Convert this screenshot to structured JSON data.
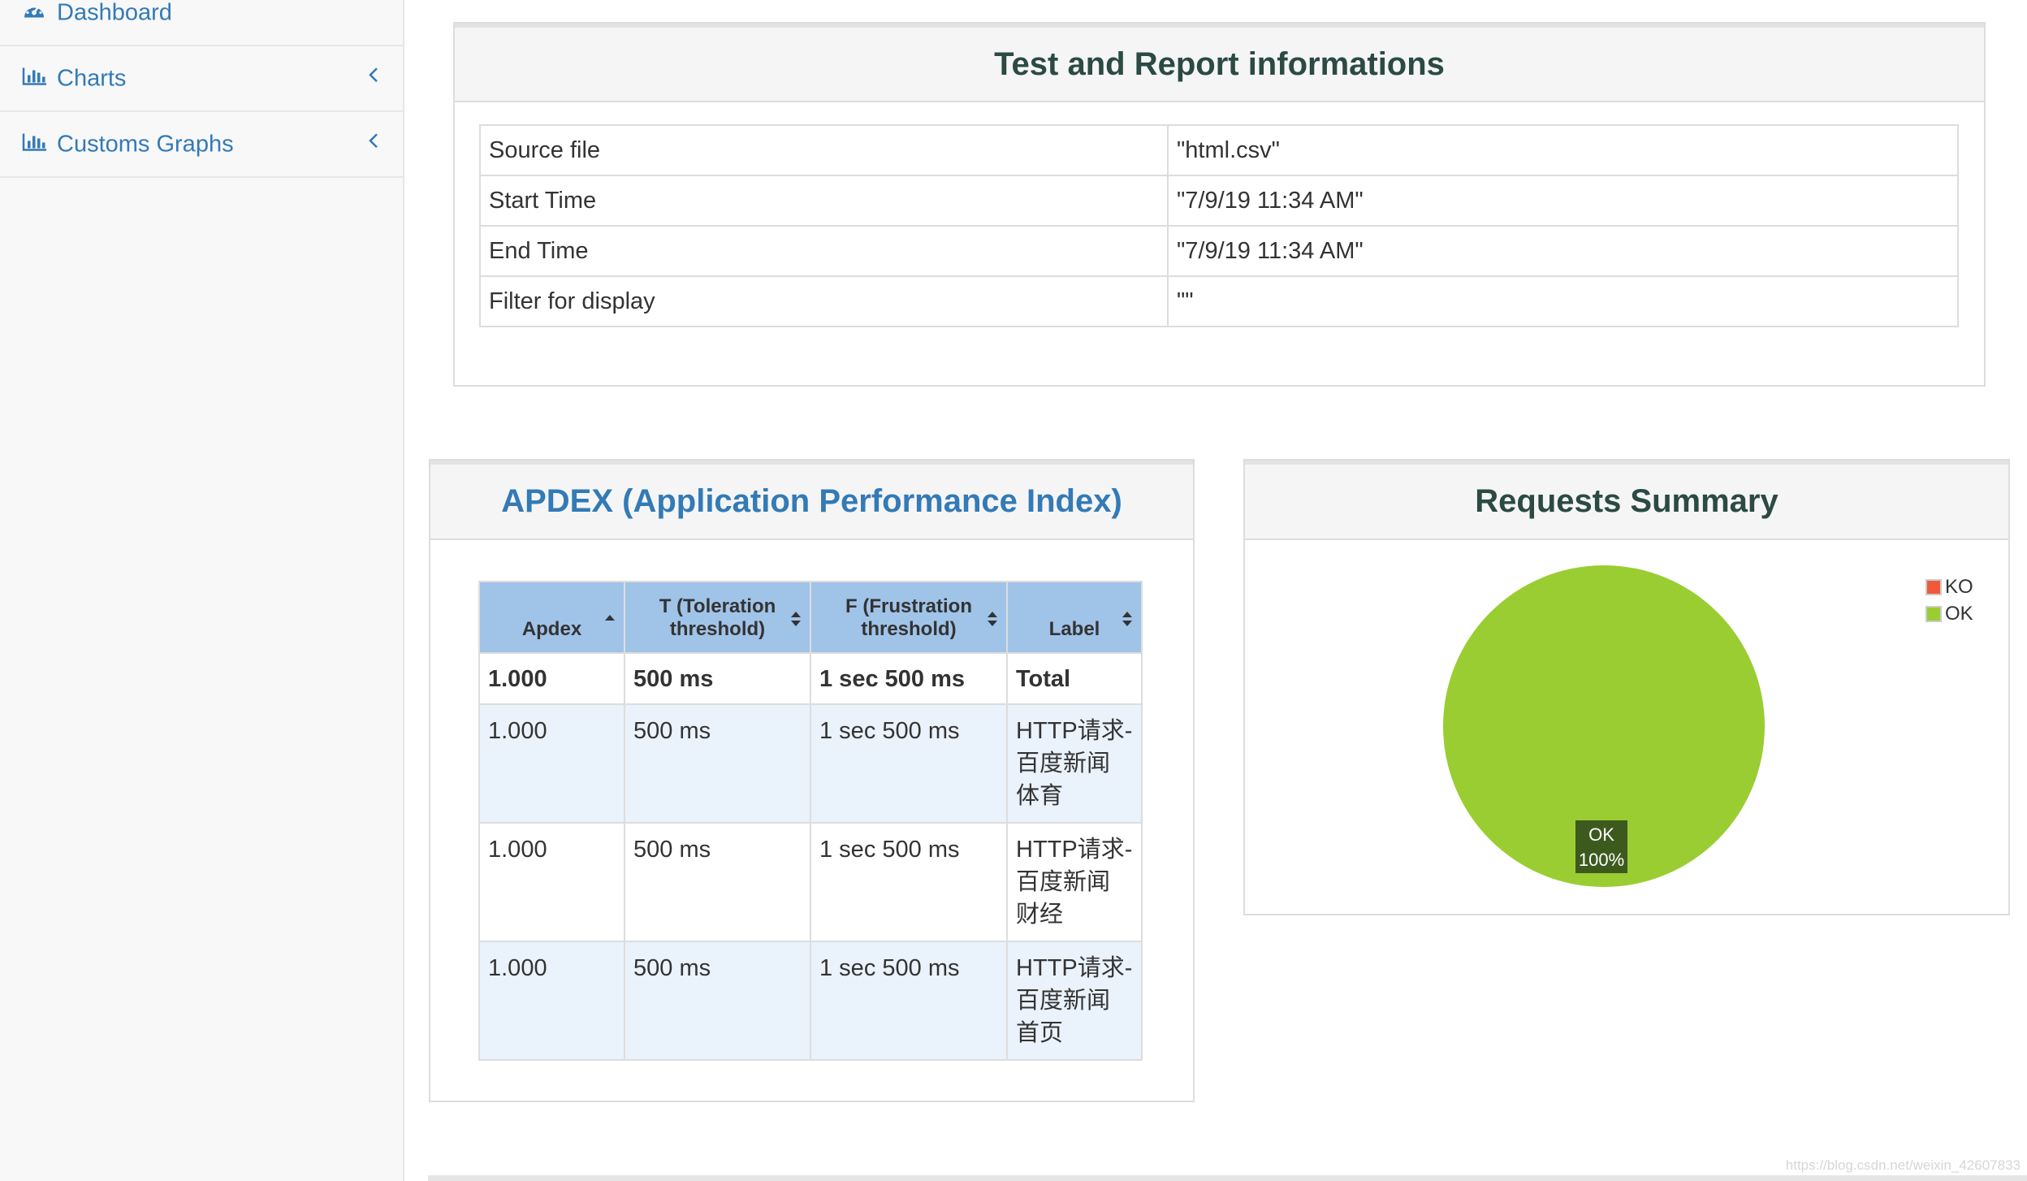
{
  "sidebar": {
    "items": [
      {
        "label": "Dashboard",
        "icon": "dashboard-icon"
      },
      {
        "label": "Charts",
        "icon": "bar-chart-icon"
      },
      {
        "label": "Customs Graphs",
        "icon": "bar-chart-icon"
      }
    ]
  },
  "info_panel": {
    "title": "Test and Report informations",
    "rows": [
      {
        "key": "Source file",
        "value": "\"html.csv\""
      },
      {
        "key": "Start Time",
        "value": "\"7/9/19 11:34 AM\""
      },
      {
        "key": "End Time",
        "value": "\"7/9/19 11:34 AM\""
      },
      {
        "key": "Filter for display",
        "value": "\"\""
      }
    ]
  },
  "apdex_panel": {
    "title": "APDEX (Application Performance Index)",
    "headers": [
      "Apdex",
      "T (Toleration threshold)",
      "F (Frustration threshold)",
      "Label"
    ],
    "header_lines": {
      "t1": "T (Toleration",
      "t2": "threshold)",
      "f1": "F (Frustration",
      "f2": "threshold)"
    },
    "total_row": {
      "apdex": "1.000",
      "t": "500 ms",
      "f": "1 sec 500 ms",
      "label": "Total"
    },
    "rows": [
      {
        "apdex": "1.000",
        "t": "500 ms",
        "f": "1 sec 500 ms",
        "label": "HTTP请求-百度新闻体育"
      },
      {
        "apdex": "1.000",
        "t": "500 ms",
        "f": "1 sec 500 ms",
        "label": "HTTP请求-百度新闻财经"
      },
      {
        "apdex": "1.000",
        "t": "500 ms",
        "f": "1 sec 500 ms",
        "label": "HTTP请求-百度新闻首页"
      }
    ]
  },
  "summary_panel": {
    "title": "Requests Summary"
  },
  "chart_data": {
    "type": "pie",
    "title": "Requests Summary",
    "slices": [
      {
        "name": "KO",
        "value": 0,
        "color": "#ef5a3c"
      },
      {
        "name": "OK",
        "value": 100,
        "color": "#9acd32"
      }
    ],
    "slice_label": {
      "name": "OK",
      "percent": "100%"
    },
    "legend_placement": "top-right"
  },
  "colors": {
    "link": "#337ab7",
    "title_dark": "#2b4a44",
    "header_blue": "#a0c3e8",
    "row_alt": "#eaf2fb"
  },
  "watermark": "https://blog.csdn.net/weixin_42607833"
}
